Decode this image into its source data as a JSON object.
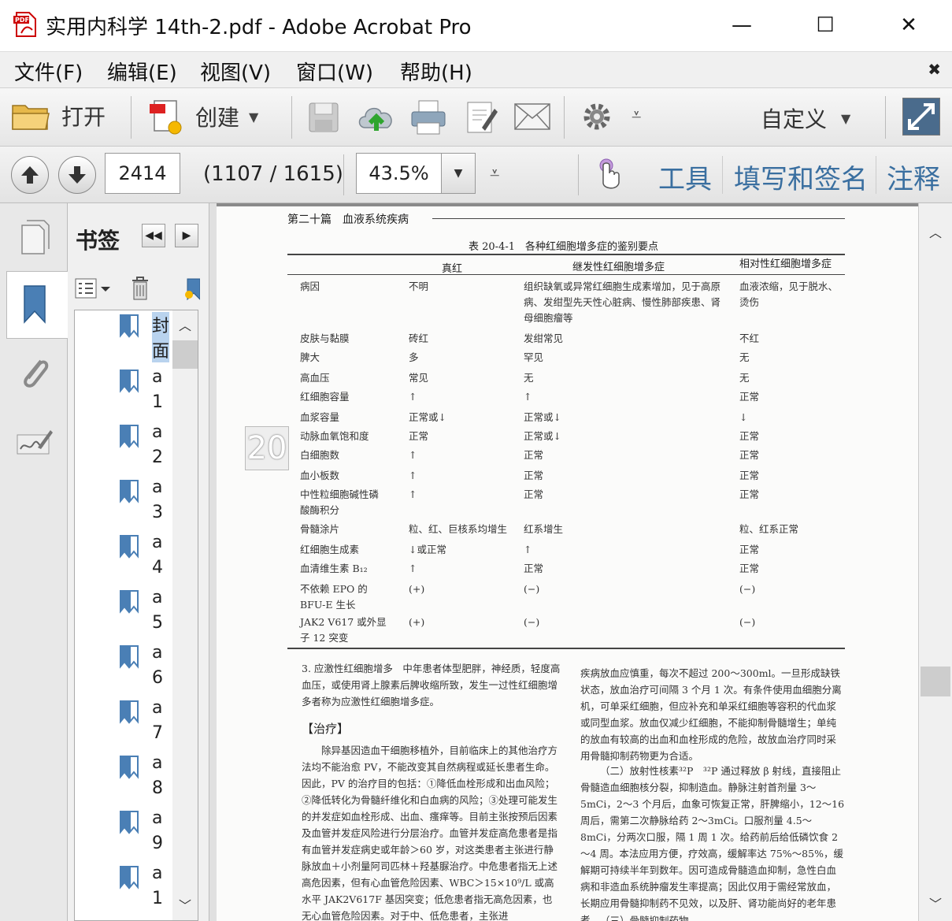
{
  "window": {
    "title": "实用内科学 14th-2.pdf - Adobe Acrobat Pro",
    "minimize_glyph": "—",
    "maximize_glyph": "☐",
    "close_glyph": "✕"
  },
  "menu": {
    "items": [
      "文件(F)",
      "编辑(E)",
      "视图(V)",
      "窗口(W)",
      "帮助(H)"
    ],
    "close_glyph": "✖"
  },
  "toolbar": {
    "open_label": "打开",
    "create_label": "创建",
    "customize_label": "自定义"
  },
  "nav": {
    "page_number": "2414",
    "page_count": "(1107 / 1615)",
    "zoom": "43.5%",
    "tools_label": "工具",
    "fill_sign_label": "填写和签名",
    "comment_label": "注释"
  },
  "bookmarks": {
    "title": "书签",
    "items": [
      {
        "l1": "封",
        "l2": "面"
      },
      {
        "l1": "a",
        "l2": "1"
      },
      {
        "l1": "a",
        "l2": "2"
      },
      {
        "l1": "a",
        "l2": "3"
      },
      {
        "l1": "a",
        "l2": "4"
      },
      {
        "l1": "a",
        "l2": "5"
      },
      {
        "l1": "a",
        "l2": "6"
      },
      {
        "l1": "a",
        "l2": "7"
      },
      {
        "l1": "a",
        "l2": "8"
      },
      {
        "l1": "a",
        "l2": "9"
      },
      {
        "l1": "a",
        "l2": "1"
      }
    ]
  },
  "page": {
    "header": "第二十篇　血液系统疾病",
    "page_marker": "20",
    "table_caption": "表 20-4-1　各种红细胞增多症的鉴别要点",
    "columns": [
      "真红",
      "继发性红细胞增多症",
      "相对性红细胞增多症"
    ],
    "rows": [
      {
        "label": "病因",
        "c1": "不明",
        "c2": "组织缺氧或异常红细胞生成素增加，见于高原病、发绀型先天性心脏病、慢性肺部疾患、肾母细胞瘤等",
        "c3": "血液浓缩，见于脱水、烫伤"
      },
      {
        "label": "皮肤与黏膜",
        "c1": "砖红",
        "c2": "发绀常见",
        "c3": "不红"
      },
      {
        "label": "脾大",
        "c1": "多",
        "c2": "罕见",
        "c3": "无"
      },
      {
        "label": "高血压",
        "c1": "常见",
        "c2": "无",
        "c3": "无"
      },
      {
        "label": "红细胞容量",
        "c1": "↑",
        "c2": "↑",
        "c3": "正常"
      },
      {
        "label": "血浆容量",
        "c1": "正常或↓",
        "c2": "正常或↓",
        "c3": "↓"
      },
      {
        "label": "动脉血氧饱和度",
        "c1": "正常",
        "c2": "正常或↓",
        "c3": "正常"
      },
      {
        "label": "白细胞数",
        "c1": "↑",
        "c2": "正常",
        "c3": "正常"
      },
      {
        "label": "血小板数",
        "c1": "↑",
        "c2": "正常",
        "c3": "正常"
      },
      {
        "label": "中性粒细胞碱性磷酸酶积分",
        "c1": "↑",
        "c2": "正常",
        "c3": "正常"
      },
      {
        "label": "骨髓涂片",
        "c1": "粒、红、巨核系均增生",
        "c2": "红系增生",
        "c3": "粒、红系正常"
      },
      {
        "label": "红细胞生成素",
        "c1": "↓或正常",
        "c2": "↑",
        "c3": "正常"
      },
      {
        "label": "血清维生素 B₁₂",
        "c1": "↑",
        "c2": "正常",
        "c3": "正常"
      },
      {
        "label": "不依赖 EPO 的 BFU-E 生长",
        "c1": "(+)",
        "c2": "(−)",
        "c3": "(−)"
      },
      {
        "label": "JAK2 V617 或外显子 12 突变",
        "c1": "(+)",
        "c2": "(−)",
        "c3": "(−)"
      }
    ],
    "left_para1": "3. 应激性红细胞增多　中年患者体型肥胖，神经质，轻度高血压，或使用肾上腺素后脾收缩所致，发生一过性红细胞增多者称为应激性红细胞增多症。",
    "treatment_heading": "【治疗】",
    "left_para2": "除异基因造血干细胞移植外，目前临床上的其他治疗方法均不能治愈 PV，不能改变其自然病程或延长患者生命。因此，PV 的治疗目的包括：①降低血栓形成和出血风险；②降低转化为骨髓纤维化和白血病的风险；③处理可能发生的并发症如血栓形成、出血、瘙痒等。目前主张按预后因素及血管并发症风险进行分层治疗。血管并发症高危患者是指有血管并发症病史或年龄＞60 岁，对这类患者主张进行静脉放血＋小剂量阿司匹林＋羟基脲治疗。中危患者指无上述高危因素，但有心血管危险因素、WBC＞15×10⁹/L 或高水平 JAK2V617F 基因突变；低危患者指无高危因素，也无心血管危险因素。对于中、低危患者，主张进",
    "right_para1": "疾病放血应慎重，每次不超过 200～300ml。一旦形成缺铁状态，放血治疗可间隔 3 个月 1 次。有条件使用血细胞分离机，可单采红细胞，但应补充和单采红细胞等容积的代血浆或同型血浆。放血仅减少红细胞，不能抑制骨髓增生；单纯的放血有较高的出血和血栓形成的危险，故放血治疗同时采用骨髓抑制药物更为合适。",
    "right_para2": "（二）放射性核素³²P　³²P 通过释放 β 射线，直接阻止骨髓造血细胞核分裂，抑制造血。静脉注射首剂量 3～5mCi，2～3 个月后，血象可恢复正常，肝脾缩小，12～16 周后，需第二次静脉给药 2～3mCi。口服剂量 4.5～8mCi，分两次口服，隔 1 周 1 次。给药前后给低磷饮食 2～4 周。本法应用方便，疗效高，缓解率达 75%～85%，缓解期可持续半年到数年。因可造成骨髓造血抑制，急性白血病和非造血系统肿瘤发生率提高；因此仅用于需经常放血，长期应用骨髓抑制药不见效，以及肝、肾功能尚好的老年患者。",
    "right_para3": "（三）骨髓抑制药物"
  },
  "colors": {
    "tab_link": "#3a6fa0",
    "page_bg": "#fbfbfa",
    "doc_bg": "#8a8a8a"
  },
  "icons": [
    "pdf-file-icon",
    "folder-icon",
    "create-pdf-icon",
    "save-icon",
    "cloud-upload-icon",
    "print-icon",
    "edit-document-icon",
    "mail-icon",
    "gear-icon",
    "expand-icon",
    "arrow-up-icon",
    "arrow-down-icon",
    "hand-icon",
    "pages-icon",
    "bookmark-icon",
    "paperclip-icon",
    "signature-icon",
    "trash-icon",
    "options-icon"
  ]
}
